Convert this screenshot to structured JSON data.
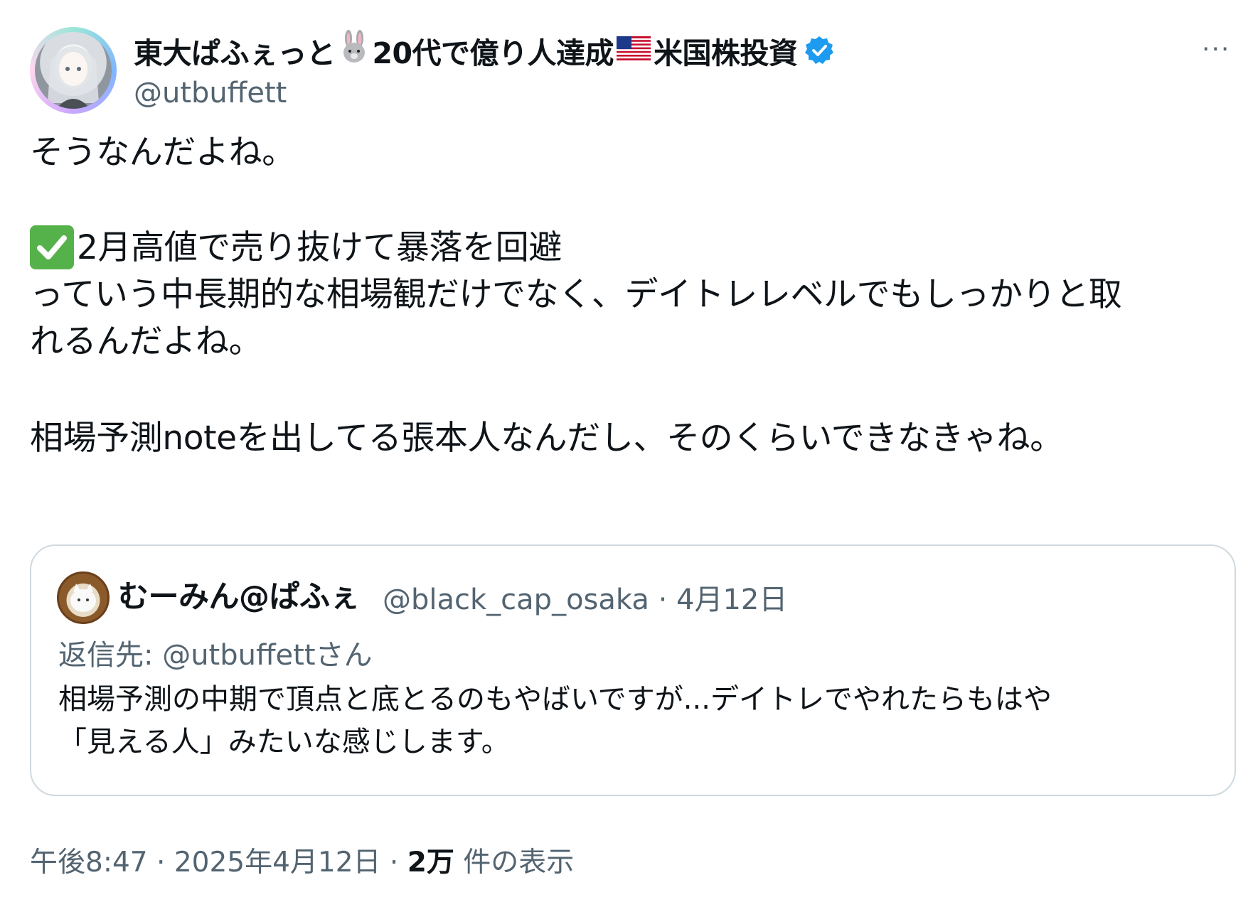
{
  "author": {
    "display_name_1": "東大ぱふぇっと",
    "emoji_1": "🐰",
    "display_name_2": "20代で億り人達成",
    "emoji_2": "🇺🇸",
    "display_name_3": "米国株投資",
    "handle": "@utbuffett",
    "avatar_icon": "anime-girl-avatar",
    "verified_icon": "verified-badge-icon"
  },
  "more_label": "···",
  "tweet": {
    "line1": "そうなんだよね。",
    "line2": "2月高値で売り抜けて暴落を回避",
    "line2_icon": "check-mark-button-icon",
    "line3": "っていう中長期的な相場観だけでなく、デイトレレベルでもしっかりと取",
    "line4": "れるんだよね。",
    "line5": "相場予測noteを出してる張本人なんだし、そのくらいできなきゃね。"
  },
  "quote": {
    "display_name": "むーみん@ぱふぇ",
    "handle": "@black_cap_osaka",
    "separator": "·",
    "date": "4月12日",
    "reply_to": "返信先: @utbuffettさん",
    "text_line1": "相場予測の中期で頂点と底とるのもやばいですが...デイトレでやれたらもはや",
    "text_line2": "「見える人」みたいな感じします。"
  },
  "footer": {
    "time": "午後8:47",
    "separator1": "·",
    "date": "2025年4月12日",
    "separator2": "·",
    "views_count": "2万",
    "views_label": "件の表示"
  },
  "colors": {
    "text": "#0f1419",
    "secondary": "#536471",
    "border": "#cfd9de",
    "verified": "#1d9bf0",
    "check": "#55b24a"
  }
}
